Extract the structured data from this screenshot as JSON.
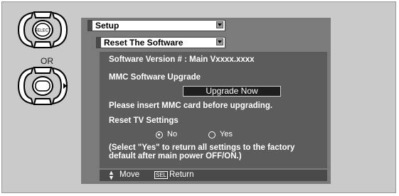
{
  "remote": {
    "select_key_label": "SELECT",
    "or_label": "OR"
  },
  "menu": {
    "setup_label": "Setup",
    "submenu_label": "Reset The Software"
  },
  "software": {
    "version_line": "Software Version # : Main Vxxxx.xxxx",
    "mmc_upgrade_label": "MMC Software Upgrade",
    "upgrade_button_label": "Upgrade Now",
    "insert_card_note": "Please insert MMC card before upgrading.",
    "reset_tv_label": "Reset TV Settings",
    "option_no": "No",
    "option_yes": "Yes",
    "selected_option": "No",
    "reset_note_line1": "(Select \"Yes\" to return all settings to the factory",
    "reset_note_line2": " default after main power OFF/ON.)"
  },
  "footer": {
    "move_icon": "up-down-arrows-icon",
    "move_label": "Move",
    "sel_key": "SEL",
    "return_label": "Return"
  }
}
